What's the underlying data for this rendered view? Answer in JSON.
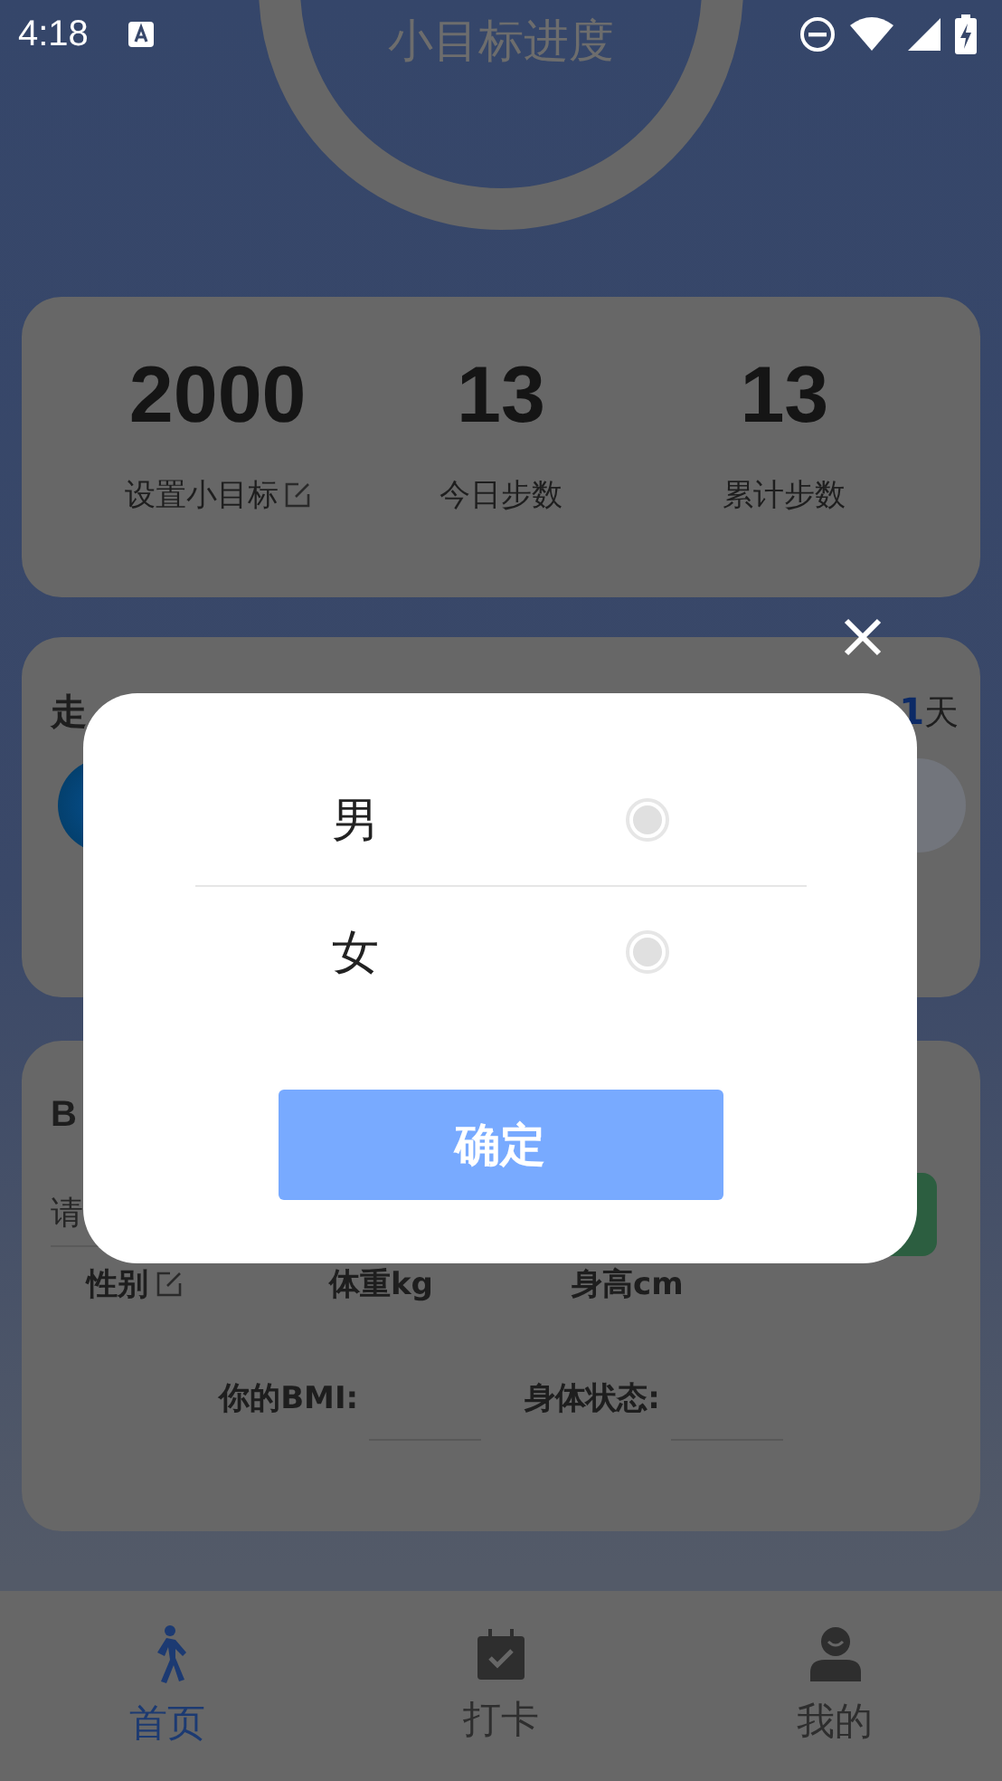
{
  "status_bar": {
    "time": "4:18"
  },
  "progress": {
    "title": "小目标进度"
  },
  "stats": [
    {
      "value": "2000",
      "label": "设置小目标",
      "editable": true
    },
    {
      "value": "13",
      "label": "今日步数",
      "editable": false
    },
    {
      "value": "13",
      "label": "累计步数",
      "editable": false
    }
  ],
  "walk_card": {
    "title": "走",
    "count": "1",
    "unit": "天"
  },
  "bmi_card": {
    "title": "B",
    "input": {
      "placeholder": "请"
    },
    "fields": [
      {
        "label": "性别",
        "editable": true
      },
      {
        "label": "体重kg",
        "editable": false
      },
      {
        "label": "身高cm",
        "editable": false
      }
    ],
    "results": [
      {
        "label": "你的BMI:"
      },
      {
        "label": "身体状态:"
      }
    ]
  },
  "tabs": [
    {
      "label": "首页",
      "selected": true,
      "kind": "walk"
    },
    {
      "label": "打卡",
      "selected": false,
      "kind": "calendar"
    },
    {
      "label": "我的",
      "selected": false,
      "kind": "person"
    }
  ],
  "dialog": {
    "options": [
      {
        "label": "男",
        "selected": false
      },
      {
        "label": "女",
        "selected": false
      }
    ],
    "confirm": "确定"
  }
}
